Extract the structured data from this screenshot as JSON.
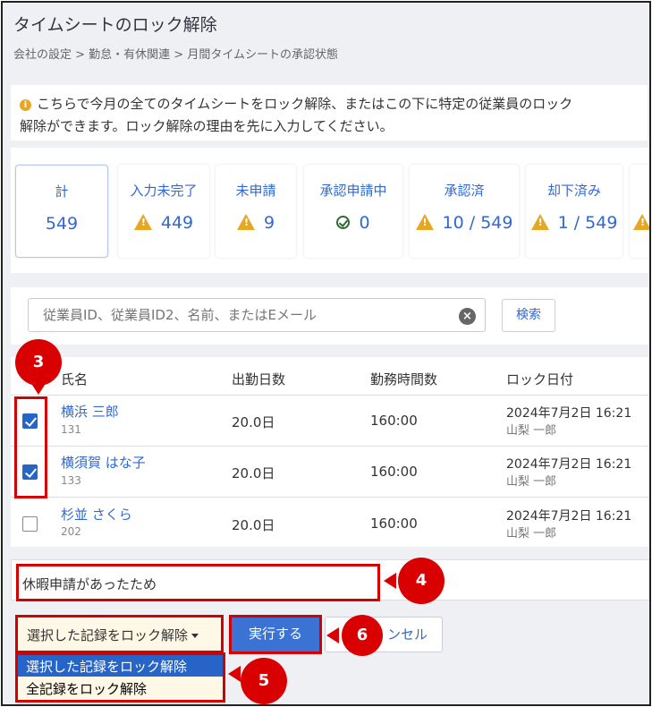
{
  "page": {
    "title": "タイムシートのロック解除",
    "breadcrumb": "会社の設定 > 勤怠・有休関連 > 月間タイムシートの承認状態"
  },
  "info": {
    "line1": "こちらで今月の全てのタイムシートをロック解除、またはこの下に特定の従業員のロック",
    "line2": "解除ができます。ロック解除の理由を先に入力してください。"
  },
  "cards": [
    {
      "label": "計",
      "value": "549",
      "icon": "none"
    },
    {
      "label": "入力未完了",
      "value": "449",
      "icon": "warning-icon"
    },
    {
      "label": "未申請",
      "value": "9",
      "icon": "warning-icon"
    },
    {
      "label": "承認申請中",
      "value": "0",
      "icon": "check-circle-icon"
    },
    {
      "label": "承認済",
      "value": "10 / 549",
      "icon": "warning-icon"
    },
    {
      "label": "却下済み",
      "value": "1 / 549",
      "icon": "warning-icon"
    }
  ],
  "search": {
    "placeholder": "従業員ID、従業員ID2、名前、またはEメール",
    "button": "検索"
  },
  "table": {
    "headers": [
      "氏名",
      "出勤日数",
      "勤務時間数",
      "ロック日付"
    ],
    "rows": [
      {
        "name": "横浜 三郎",
        "id": "131",
        "days": "20.0日",
        "hours": "160:00",
        "lock_date": "2024年7月2日 16:21",
        "locked_by": "山梨 一郎",
        "checked": true
      },
      {
        "name": "横須賀 はな子",
        "id": "133",
        "days": "20.0日",
        "hours": "160:00",
        "lock_date": "2024年7月2日 16:21",
        "locked_by": "山梨 一郎",
        "checked": true
      },
      {
        "name": "杉並 さくら",
        "id": "202",
        "days": "20.0日",
        "hours": "160:00",
        "lock_date": "2024年7月2日 16:21",
        "locked_by": "山梨 一郎",
        "checked": false
      }
    ]
  },
  "reason": {
    "value": "休暇申請があったため"
  },
  "actions": {
    "dropdown_label": "選択した記録をロック解除",
    "menu": [
      "選択した記録をロック解除",
      "全記録をロック解除"
    ],
    "run": "実行する",
    "cancel": "ンセル"
  },
  "markers": [
    "3",
    "4",
    "5",
    "6"
  ],
  "colors": {
    "accent": "#3168d0",
    "warning": "#e6a823",
    "marker": "#d80000",
    "primary_button": "#3a73d4"
  }
}
